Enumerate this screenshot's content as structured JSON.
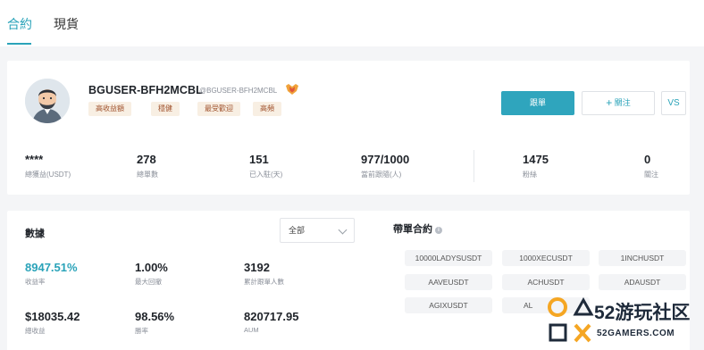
{
  "tabs": [
    {
      "label": "合約"
    },
    {
      "label": "現貨"
    }
  ],
  "profile": {
    "username": "BGUSER-BFH2MCBL",
    "handle": "@BGUSER-BFH2MCBL",
    "tags": [
      "高收益額",
      "穩健",
      "最受歡迎",
      "高頻"
    ],
    "follow_order_label": "跟單",
    "follow_label": "關注",
    "vs_label": "VS"
  },
  "stats": [
    {
      "value": "****",
      "label": "總獲益(USDT)"
    },
    {
      "value": "278",
      "label": "總單數"
    },
    {
      "value": "151",
      "label": "已入駐(天)"
    },
    {
      "value": "977/1000",
      "label": "當前跟隨(人)"
    },
    {
      "value": "1475",
      "label": "粉絲"
    },
    {
      "value": "0",
      "label": "關注"
    }
  ],
  "data_section": {
    "title": "數據",
    "filter_value": "全部",
    "metrics": [
      {
        "value": "8947.51%",
        "label": "收益率"
      },
      {
        "value": "1.00%",
        "label": "最大回撤"
      },
      {
        "value": "3192",
        "label": "累計跟單人數"
      },
      {
        "value": "$18035.42",
        "label": "總收益"
      },
      {
        "value": "98.56%",
        "label": "勝率"
      },
      {
        "value": "820717.95",
        "label": "AUM"
      }
    ]
  },
  "contracts_section": {
    "title": "帶單合約",
    "items": [
      "10000LADYSUSDT",
      "1000XECUSDT",
      "1INCHUSDT",
      "AAVEUSDT",
      "ACHUSDT",
      "ADAUSDT",
      "AGIXUSDT",
      "AL"
    ]
  },
  "watermark": {
    "brand": "52游玩社区",
    "url": "52GAMERS.COM"
  },
  "colors": {
    "accent": "#2aa3b9",
    "tag_text": "#a0522d",
    "tag_bg": "#f8efe3"
  }
}
